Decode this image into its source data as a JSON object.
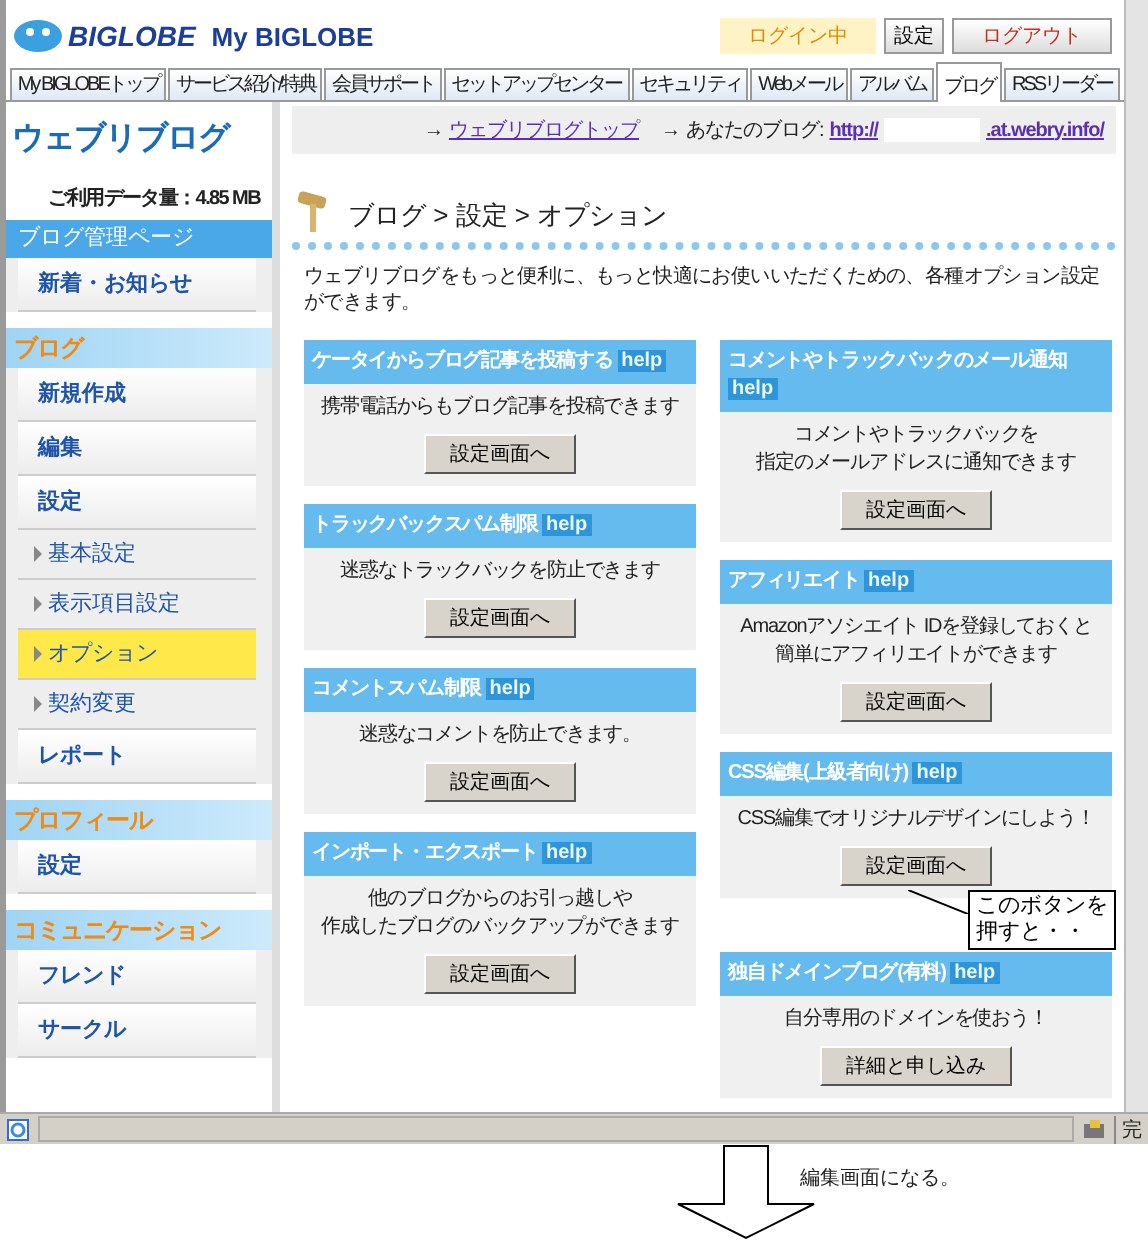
{
  "header": {
    "logo": "BIGLOBE",
    "brand": "My BIGLOBE",
    "login_status": "ログイン中",
    "settings_button": "設定",
    "logout_button": "ログアウト"
  },
  "tabs": [
    {
      "label": "My BIGLOBEトップ",
      "selected": false
    },
    {
      "label": "サービス紹介/特典",
      "selected": false
    },
    {
      "label": "会員サポート",
      "selected": false
    },
    {
      "label": "セットアップセンター",
      "selected": false
    },
    {
      "label": "セキュリティ",
      "selected": false
    },
    {
      "label": "Webメール",
      "selected": false
    },
    {
      "label": "アルバム",
      "selected": false
    },
    {
      "label": "ブログ",
      "selected": true
    },
    {
      "label": "RSSリーダー",
      "selected": false
    }
  ],
  "sidebar": {
    "title": "ウェブリブログ",
    "data_usage": "ご利用データ量：4.85 MB",
    "sections": [
      {
        "heading": "ブログ管理ページ",
        "kind": "plain",
        "items": [
          {
            "label": "新着・お知らせ",
            "selected": false
          }
        ]
      },
      {
        "heading": "ブログ",
        "kind": "decorated",
        "items": [
          {
            "label": "新規作成",
            "selected": false
          },
          {
            "label": "編集",
            "selected": false
          },
          {
            "label": "設定",
            "selected": false,
            "children": [
              {
                "label": "基本設定",
                "selected": false
              },
              {
                "label": "表示項目設定",
                "selected": false
              },
              {
                "label": "オプション",
                "selected": true
              },
              {
                "label": "契約変更",
                "selected": false
              }
            ]
          },
          {
            "label": "レポート",
            "selected": false
          }
        ]
      },
      {
        "heading": "プロフィール",
        "kind": "decorated",
        "items": [
          {
            "label": "設定",
            "selected": false
          }
        ]
      },
      {
        "heading": "コミュニケーション",
        "kind": "decorated",
        "items": [
          {
            "label": "フレンド",
            "selected": false
          },
          {
            "label": "サークル",
            "selected": false
          }
        ]
      }
    ]
  },
  "top_bar": {
    "link_arrow": "→",
    "link": "ウェブリブログトップ",
    "blog_arrow": "→",
    "blog_label": "あなたのブログ:",
    "url_prefix": "http://",
    "url_suffix": ".at.webry.info/"
  },
  "breadcrumb": "ブログ > 設定 > オプション",
  "intro": "ウェブリブログをもっと便利に、もっと快適にお使いいただくための、各種オプション設定ができます。",
  "cards": [
    [
      {
        "title": "ケータイからブログ記事を投稿する",
        "help": "help",
        "lines": [
          "携帯電話からもブログ記事を投稿できます"
        ],
        "button": "設定画面へ"
      },
      {
        "title": "トラックバックスパム制限",
        "help": "help",
        "lines": [
          "迷惑なトラックバックを防止できます"
        ],
        "button": "設定画面へ"
      },
      {
        "title": "コメントスパム制限",
        "help": "help",
        "lines": [
          "迷惑なコメントを防止できます。"
        ],
        "button": "設定画面へ"
      },
      {
        "title": "インポート・エクスポート",
        "help": "help",
        "lines": [
          "他のブログからのお引っ越しや",
          "作成したブログのバックアップができます"
        ],
        "button": "設定画面へ"
      }
    ],
    [
      {
        "title": "コメントやトラックバックのメール通知",
        "help": "help",
        "lines": [
          "コメントやトラックバックを",
          "指定のメールアドレスに通知できます"
        ],
        "button": "設定画面へ"
      },
      {
        "title": "アフィリエイト",
        "help": "help",
        "lines": [
          "Amazonアソシエイト IDを登録しておくと",
          "簡単にアフィリエイトができます"
        ],
        "button": "設定画面へ"
      },
      {
        "title": "CSS編集(上級者向け)",
        "help": "help",
        "lines": [
          "CSS編集でオリジナルデザインにしよう！"
        ],
        "button": "設定画面へ",
        "callout": [
          "このボタンを",
          "押すと・・"
        ]
      },
      {
        "title": "独自ドメインブログ(有料)",
        "help": "help",
        "lines": [
          "自分専用のドメインを使おう！"
        ],
        "button": "詳細と申し込み"
      }
    ]
  ],
  "status_bar": {
    "text": "完"
  },
  "annotation": {
    "text": "編集画面になる。"
  }
}
